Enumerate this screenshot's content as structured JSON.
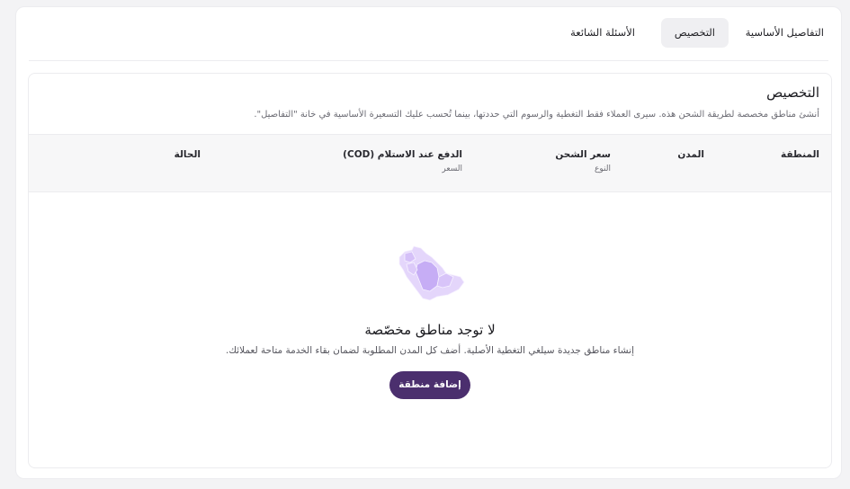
{
  "tabs": [
    {
      "label": "التفاصيل الأساسية",
      "active": false
    },
    {
      "label": "التخصيص",
      "active": true
    },
    {
      "label": "الأسئلة الشائعة",
      "active": false
    }
  ],
  "section": {
    "title": "التخصيص",
    "description": "أنشئ مناطق مخصصة لطريقة الشحن هذه. سيرى العملاء فقط التغطية والرسوم التي حددتها، بينما تُحسب عليك التسعيرة الأساسية في خانة \"التفاصيل\"."
  },
  "table": {
    "columns": [
      {
        "label": "المنطقة",
        "sub": ""
      },
      {
        "label": "المدن",
        "sub": ""
      },
      {
        "label": "سعر الشحن",
        "sub": "النوع"
      },
      {
        "label": "الدفع عند الاستلام (COD)",
        "sub": "السعر"
      },
      {
        "label": "الحالة",
        "sub": ""
      }
    ]
  },
  "empty_state": {
    "icon": "saudi-map-icon",
    "title": "لا توجد مناطق مخصّصة",
    "description": "إنشاء مناطق جديدة سيلغي التغطية الأصلية. أضف كل المدن المطلوبة لضمان بقاء الخدمة متاحة لعملائك.",
    "button_label": "إضافة منطقة"
  },
  "colors": {
    "accent": "#4b2f6e",
    "map_fill_light": "#e4d6fb",
    "map_fill_dark": "#c6adf5"
  }
}
